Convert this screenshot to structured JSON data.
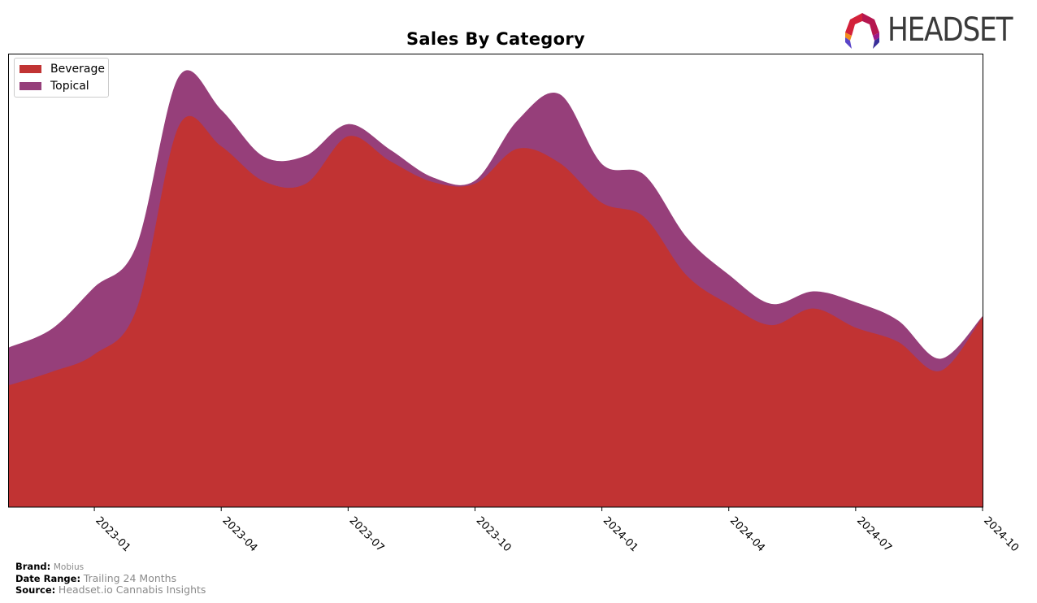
{
  "chart_data": {
    "type": "area",
    "stacked": true,
    "smooth": true,
    "title": "Sales By Category",
    "xlabel": "",
    "ylabel": "",
    "x": [
      "2022-11",
      "2022-12",
      "2023-01",
      "2023-02",
      "2023-03",
      "2023-04",
      "2023-05",
      "2023-06",
      "2023-07",
      "2023-08",
      "2023-09",
      "2023-10",
      "2023-11",
      "2023-12",
      "2024-01",
      "2024-02",
      "2024-03",
      "2024-04",
      "2024-05",
      "2024-06",
      "2024-07",
      "2024-08",
      "2024-09",
      "2024-10"
    ],
    "x_ticks": [
      "2023-01",
      "2023-04",
      "2023-07",
      "2023-10",
      "2024-01",
      "2024-04",
      "2024-07",
      "2024-10"
    ],
    "x_range": [
      "2022-11",
      "2024-10"
    ],
    "y_ticks_visible": false,
    "ylim": [
      0,
      545
    ],
    "grid": false,
    "legend_position": "top-left",
    "series": [
      {
        "name": "Beverage",
        "color": "#c13333",
        "values": [
          147,
          163,
          184,
          239,
          459,
          434,
          392,
          389,
          446,
          416,
          391,
          389,
          431,
          414,
          366,
          349,
          279,
          244,
          219,
          239,
          216,
          199,
          164,
          229
        ]
      },
      {
        "name": "Topical",
        "color": "#963f7a",
        "values": [
          45,
          51,
          80,
          75,
          58,
          43,
          29,
          33,
          14,
          13,
          5,
          3,
          33,
          82,
          46,
          50,
          45,
          35,
          25,
          20,
          30,
          25,
          14,
          0
        ]
      }
    ]
  },
  "legend": {
    "items": [
      {
        "label": "Beverage",
        "color": "#c13333"
      },
      {
        "label": "Topical",
        "color": "#963f7a"
      }
    ]
  },
  "logo": {
    "text": "HEADSET"
  },
  "footer": {
    "brand_key": "Brand:",
    "brand_value": "Mobius",
    "date_key": "Date Range:",
    "date_value": "Trailing 24 Months",
    "source_key": "Source:",
    "source_value": "Headset.io Cannabis Insights"
  }
}
